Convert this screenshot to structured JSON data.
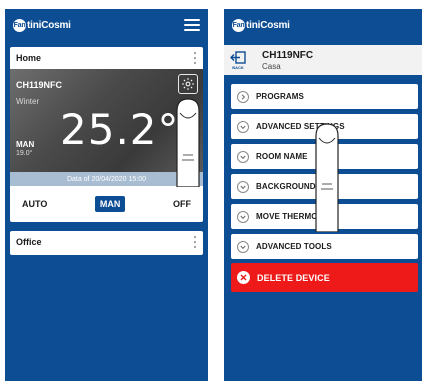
{
  "brand": {
    "logo_mark": "Fan",
    "logo_text": "tiniCosmi"
  },
  "left": {
    "home_card": {
      "title": "Home",
      "thermostat_name": "CH119NFC",
      "season": "Winter",
      "temperature": "25.2°",
      "mode": "MAN",
      "setpoint": "19.0°",
      "date": "Data of 20/04/2020 15:00"
    },
    "mode_buttons": [
      {
        "label": "AUTO",
        "active": false
      },
      {
        "label": "MAN",
        "active": true
      },
      {
        "label": "OFF",
        "active": false
      }
    ],
    "office_card": {
      "title": "Office"
    }
  },
  "right": {
    "back_label": "BACK",
    "device_name": "CH119NFC",
    "device_room": "Casa",
    "options": [
      {
        "label": "PROGRAMS",
        "icon": "chevron-right-icon"
      },
      {
        "label": "ADVANCED SETTINGS",
        "icon": "chevron-down-icon"
      },
      {
        "label": "ROOM NAME",
        "icon": "chevron-down-icon"
      },
      {
        "label": "BACKGROUND",
        "icon": "chevron-down-icon"
      },
      {
        "label": "MOVE THERMOSTAT",
        "icon": "chevron-down-icon"
      },
      {
        "label": "ADVANCED TOOLS",
        "icon": "chevron-down-icon"
      }
    ],
    "delete_label": "DELETE DEVICE"
  },
  "colors": {
    "primary": "#0d4d94",
    "danger": "#ee1a1a",
    "date_bar": "#a9bdd2"
  }
}
